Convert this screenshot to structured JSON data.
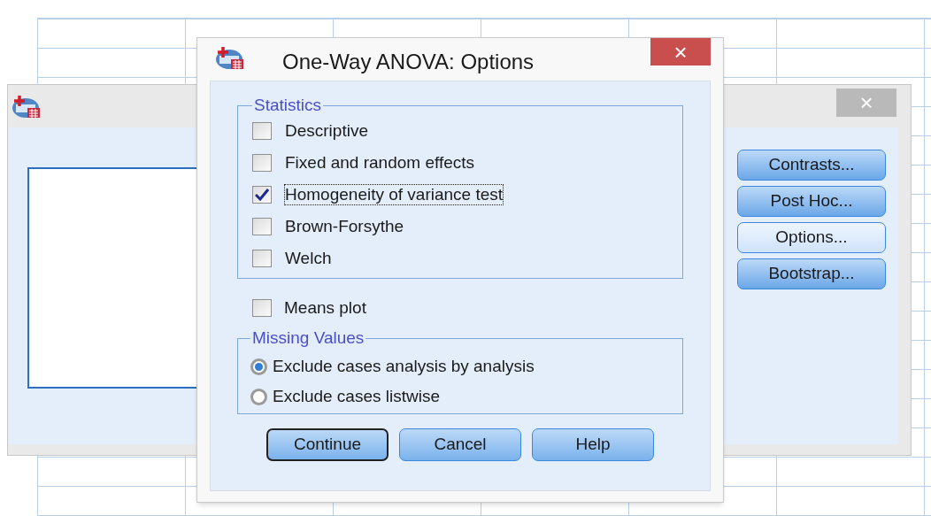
{
  "main_dialog": {
    "close": "×",
    "buttons": [
      {
        "label": "Contrasts...",
        "active": false
      },
      {
        "label": "Post Hoc...",
        "active": false
      },
      {
        "label": "Options...",
        "active": true
      },
      {
        "label": "Bootstrap...",
        "active": false
      }
    ]
  },
  "options_dialog": {
    "title": "One-Way ANOVA: Options",
    "close": "×",
    "statistics": {
      "legend": "Statistics",
      "items": [
        {
          "label": "Descriptive",
          "checked": false,
          "focused": false
        },
        {
          "label": "Fixed and random effects",
          "checked": false,
          "focused": false
        },
        {
          "label": "Homogeneity of variance test",
          "checked": true,
          "focused": true
        },
        {
          "label": "Brown-Forsythe",
          "checked": false,
          "focused": false
        },
        {
          "label": "Welch",
          "checked": false,
          "focused": false
        }
      ]
    },
    "means_plot": {
      "label": "Means plot",
      "checked": false
    },
    "missing_values": {
      "legend": "Missing Values",
      "options": [
        {
          "label": "Exclude cases analysis by analysis",
          "selected": true
        },
        {
          "label": "Exclude cases listwise",
          "selected": false
        }
      ]
    },
    "buttons": [
      {
        "label": "Continue",
        "default": true
      },
      {
        "label": "Cancel",
        "default": false
      },
      {
        "label": "Help",
        "default": false
      }
    ]
  }
}
